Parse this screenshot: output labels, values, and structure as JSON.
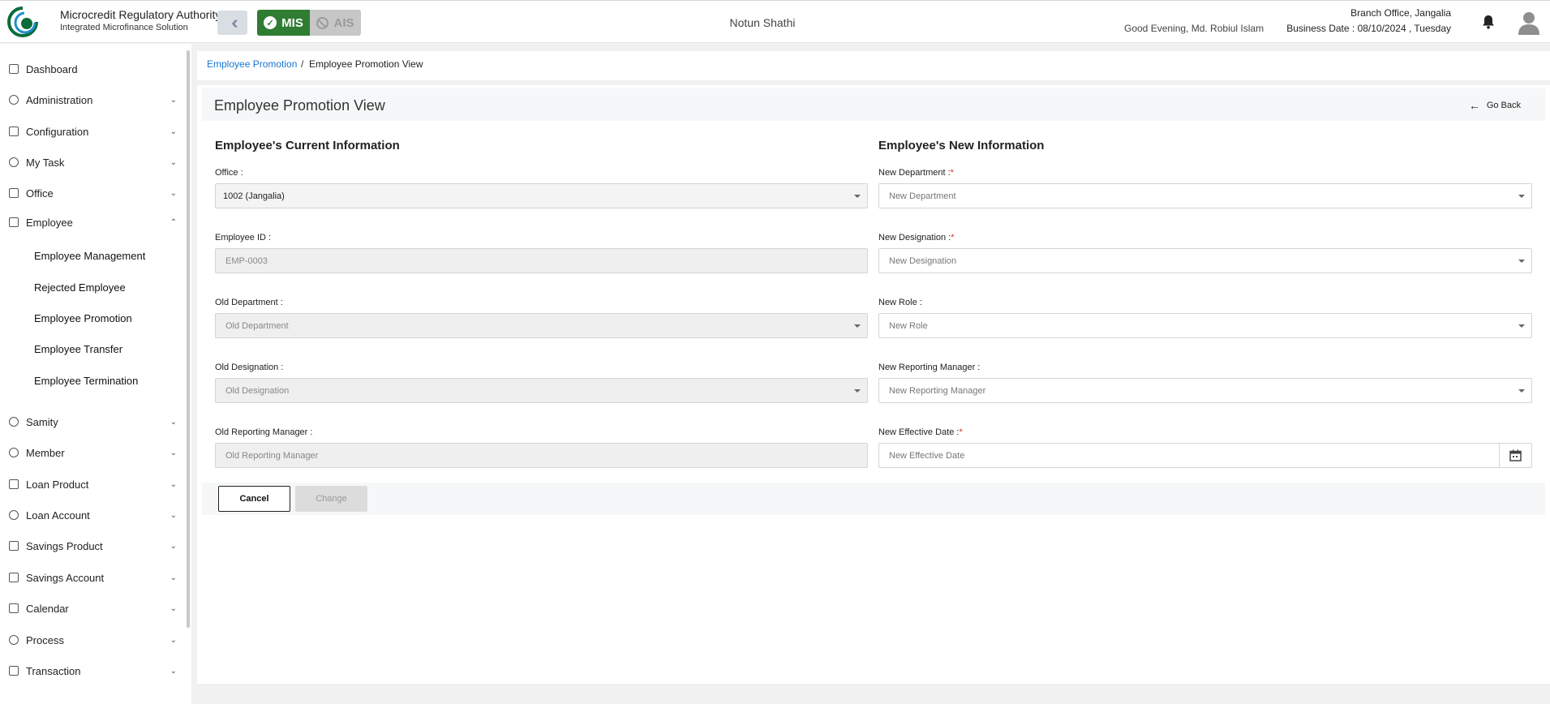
{
  "header": {
    "brand_title": "Microcredit Regulatory Authority",
    "brand_subtitle": "Integrated Microfinance Solution",
    "logo_text": "Microcredit Regulatory Authority",
    "mis_label": "MIS",
    "ais_label": "AIS",
    "center_title": "Notun Shathi",
    "greeting": "Good Evening, Md. Robiul Islam",
    "branch": "Branch Office, Jangalia",
    "business_date": "Business Date : 08/10/2024 , Tuesday",
    "accent_color": "#2e7d32"
  },
  "sidebar": {
    "items": [
      {
        "label": "Dashboard"
      },
      {
        "label": "Administration"
      },
      {
        "label": "Configuration"
      },
      {
        "label": "My Task"
      },
      {
        "label": "Office"
      },
      {
        "label": "Employee"
      },
      {
        "label": "Samity"
      },
      {
        "label": "Member"
      },
      {
        "label": "Loan Product"
      },
      {
        "label": "Loan Account"
      },
      {
        "label": "Savings Product"
      },
      {
        "label": "Savings Account"
      },
      {
        "label": "Calendar"
      },
      {
        "label": "Process"
      },
      {
        "label": "Transaction"
      }
    ],
    "employee_sub": [
      {
        "label": "Employee Management"
      },
      {
        "label": "Rejected Employee"
      },
      {
        "label": "Employee Promotion"
      },
      {
        "label": "Employee Transfer"
      },
      {
        "label": "Employee Termination"
      }
    ]
  },
  "breadcrumb": {
    "parent": "Employee Promotion",
    "separator": "/",
    "current": "Employee Promotion View"
  },
  "page": {
    "title": "Employee Promotion View",
    "go_back": "Go Back"
  },
  "current_info": {
    "title": "Employee's Current Information",
    "office_label": "Office :",
    "office_value": "1002 (Jangalia)",
    "employee_id_label": "Employee ID :",
    "employee_id_value": "EMP-0003",
    "old_department_label": "Old Department :",
    "old_department_placeholder": "Old Department",
    "old_designation_label": "Old Designation :",
    "old_designation_placeholder": "Old Designation",
    "old_manager_label": "Old Reporting Manager :",
    "old_manager_placeholder": "Old Reporting Manager"
  },
  "new_info": {
    "title": "Employee's New Information",
    "department_label": "New Department :",
    "department_placeholder": "New Department",
    "designation_label": "New Designation :",
    "designation_placeholder": "New Designation",
    "role_label": "New Role :",
    "role_placeholder": "New Role",
    "manager_label": "New Reporting Manager :",
    "manager_placeholder": "New Reporting Manager",
    "effective_date_label": "New Effective Date :",
    "effective_date_placeholder": "New Effective Date",
    "required_mark": "*"
  },
  "actions": {
    "cancel": "Cancel",
    "change": "Change"
  }
}
